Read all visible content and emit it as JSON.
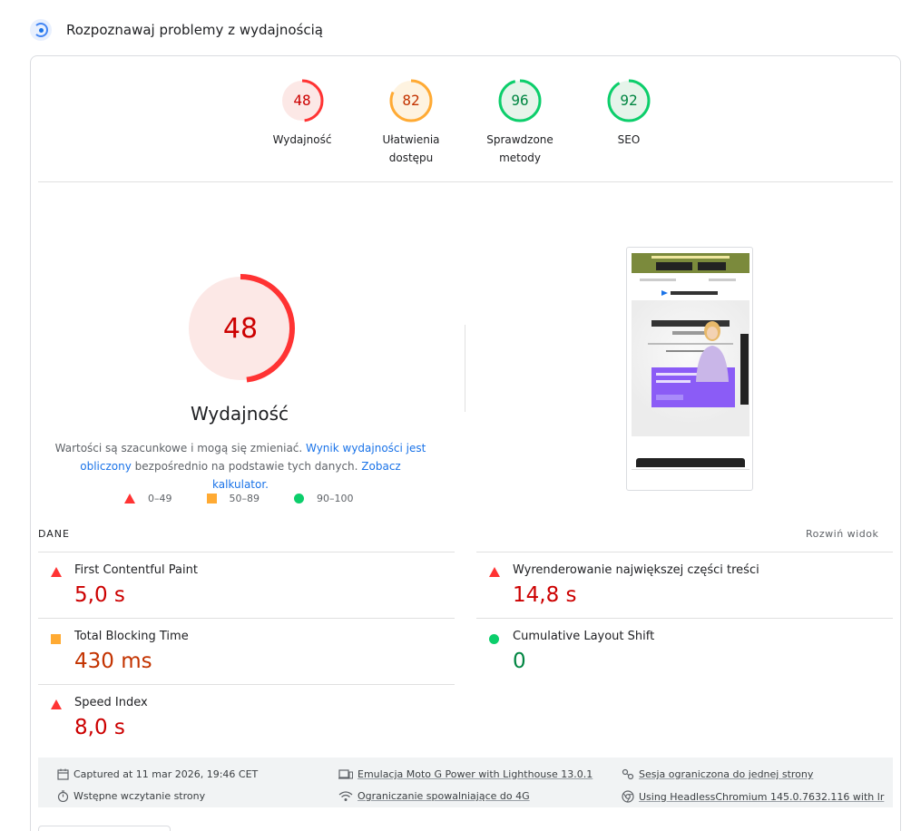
{
  "header": {
    "title": "Rozpoznawaj problemy z wydajnością",
    "icon": "lighthouse-icon"
  },
  "categories": [
    {
      "score": "48",
      "value": 48,
      "label_line1": "Wydajność",
      "label_line2": "",
      "color": "#ff3333",
      "fill": "#fce8e6",
      "text_color": "#c00"
    },
    {
      "score": "82",
      "value": 82,
      "label_line1": "Ułatwienia",
      "label_line2": "dostępu",
      "color": "#ffaa33",
      "fill": "#fef3e0",
      "text_color": "#c33300"
    },
    {
      "score": "96",
      "value": 96,
      "label_line1": "Sprawdzone",
      "label_line2": "metody",
      "color": "#0cce6b",
      "fill": "#e6f4ea",
      "text_color": "#018642"
    },
    {
      "score": "92",
      "value": 92,
      "label_line1": "SEO",
      "label_line2": "",
      "color": "#0cce6b",
      "fill": "#e6f4ea",
      "text_color": "#018642"
    }
  ],
  "performance": {
    "score": "48",
    "value": 48,
    "title": "Wydajność",
    "desc_part1": "Wartości są szacunkowe i mogą się zmieniać. ",
    "desc_link1": "Wynik wydajności jest obliczony",
    "desc_part2": " bezpośrednio na podstawie tych danych. ",
    "desc_link2": "Zobacz kalkulator."
  },
  "legend": [
    {
      "range": "0–49",
      "shape": "triangle",
      "color": "#ff3333"
    },
    {
      "range": "50–89",
      "shape": "square",
      "color": "#ffaa33"
    },
    {
      "range": "90–100",
      "shape": "circle",
      "color": "#0cce6b"
    }
  ],
  "metrics_section": {
    "label": "DANE",
    "expand_label": "Rozwiń widok"
  },
  "metrics": [
    {
      "name": "First Contentful Paint",
      "value": "5,0 s",
      "status": "red"
    },
    {
      "name": "Wyrenderowanie największej części treści",
      "value": "14,8 s",
      "status": "red"
    },
    {
      "name": "Total Blocking Time",
      "value": "430 ms",
      "status": "orange"
    },
    {
      "name": "Cumulative Layout Shift",
      "value": "0",
      "status": "green"
    },
    {
      "name": "Speed Index",
      "value": "8,0 s",
      "status": "red"
    }
  ],
  "footer": {
    "captured": "Captured at 11 mar 2026, 19:46 CET",
    "emulation": "Emulacja Moto G Power with Lighthouse 13.0.1",
    "session": "Sesja ograniczona do jednej strony",
    "preload": "Wstępne wczytanie strony",
    "throttling": "Ograniczanie spowalniające do 4G",
    "browser": "Using HeadlessChromium 145.0.7632.116 with lr"
  }
}
